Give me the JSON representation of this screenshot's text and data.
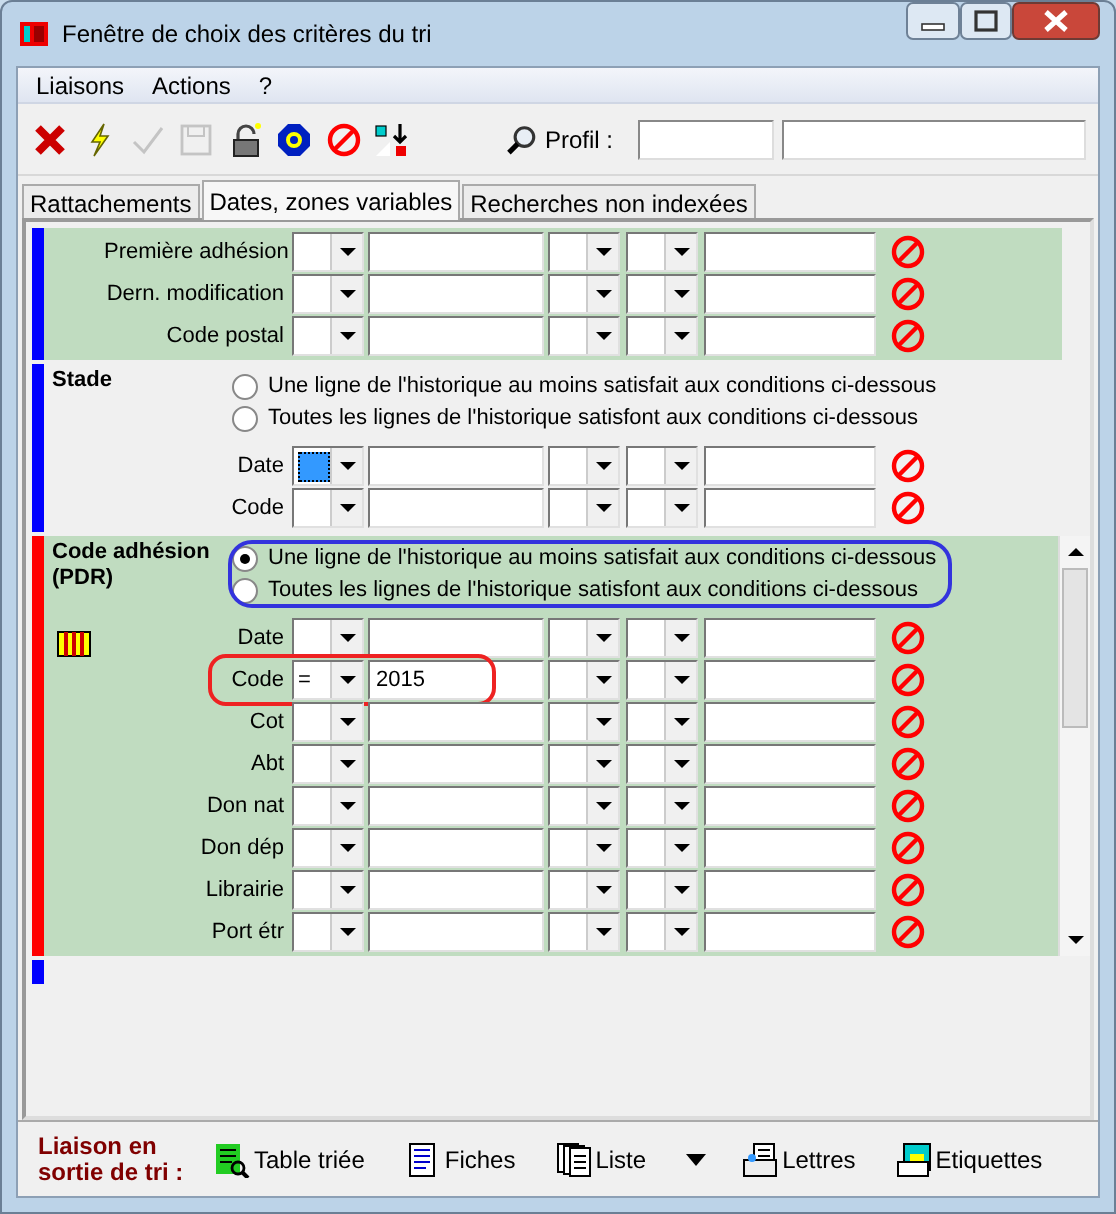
{
  "window": {
    "title": "Fenêtre de choix des critères du tri"
  },
  "menu": [
    "Liaisons",
    "Actions",
    "?"
  ],
  "toolbar": {
    "tools": [
      {
        "kind": "cancel",
        "disabled": false
      },
      {
        "kind": "run",
        "disabled": false
      },
      {
        "kind": "confirm",
        "disabled": true
      },
      {
        "kind": "save",
        "disabled": true
      },
      {
        "kind": "lock",
        "disabled": false
      },
      {
        "kind": "help",
        "disabled": false
      },
      {
        "kind": "clear",
        "disabled": false
      },
      {
        "kind": "transfer",
        "disabled": false
      }
    ],
    "profile_label": "Profil :"
  },
  "tabs": [
    {
      "label": "Rattachements",
      "selected": false
    },
    {
      "label": "Dates, zones variables",
      "selected": true
    },
    {
      "label": "Recherches non indexées",
      "selected": false
    }
  ],
  "sections": [
    {
      "color": "#0000ff",
      "shaded": true,
      "rows": [
        {
          "label": "Première adhésion",
          "focused": false
        },
        {
          "label": "Dern. modification",
          "focused": false
        },
        {
          "label": "Code postal",
          "focused": false
        }
      ]
    },
    {
      "color": "#0000ff",
      "shaded": false,
      "title": "Stade",
      "options": [
        {
          "label": "Une ligne de l'historique au moins satisfait aux conditions ci-dessous",
          "selected": false
        },
        {
          "label": "Toutes les lignes de l'historique satisfont aux conditions ci-dessous",
          "selected": false
        }
      ],
      "rows": [
        {
          "label": "Date",
          "focused": true
        },
        {
          "label": "Code",
          "focused": false
        }
      ]
    },
    {
      "color": "#ff0000",
      "shaded": true,
      "title": "Code adhésion (PDR)",
      "scrollable": true,
      "options": [
        {
          "label": "Une ligne de l'historique au moins satisfait aux conditions ci-dessous",
          "selected": true
        },
        {
          "label": "Toutes les lignes de l'historique satisfont aux conditions ci-dessous",
          "selected": false
        }
      ],
      "rows": [
        {
          "label": "Date",
          "focused": false,
          "highlighted": false
        },
        {
          "label": "Code",
          "focused": false,
          "operator": "=",
          "value": "2015",
          "highlighted": true
        },
        {
          "label": "Cot",
          "focused": false,
          "highlighted": false
        },
        {
          "label": "Abt",
          "focused": false,
          "highlighted": false
        },
        {
          "label": "Don nat",
          "focused": false,
          "highlighted": false
        },
        {
          "label": "Don dép",
          "focused": false,
          "highlighted": false
        },
        {
          "label": "Librairie",
          "focused": false,
          "highlighted": false
        },
        {
          "label": "Port étr",
          "focused": false,
          "highlighted": false
        }
      ]
    },
    {
      "color": "#0000ff",
      "shaded": false
    }
  ],
  "footer": {
    "label": "Liaison en sortie de tri :",
    "buttons": [
      {
        "kind": "table",
        "label": "Table triée"
      },
      {
        "kind": "sheet",
        "label": "Fiches"
      },
      {
        "kind": "list",
        "label": "Liste"
      },
      {
        "kind": "letters",
        "label": "Lettres"
      },
      {
        "kind": "labels",
        "label": "Etiquettes"
      }
    ]
  }
}
